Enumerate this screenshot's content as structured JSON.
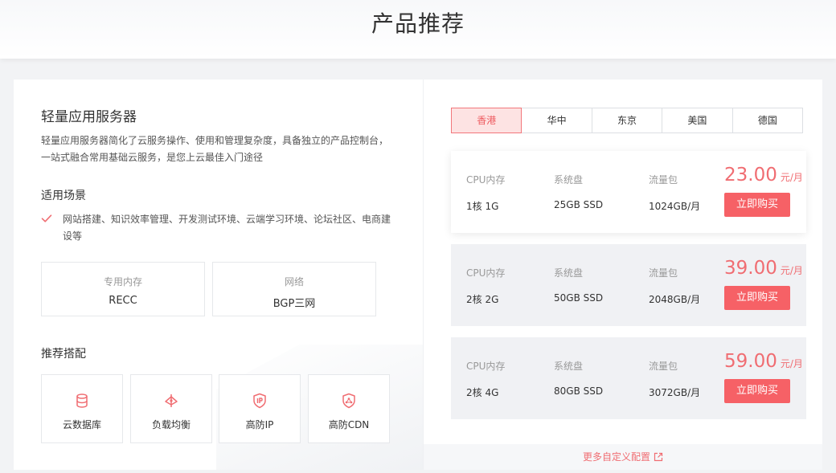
{
  "header": {
    "title": "产品推荐"
  },
  "product": {
    "title": "轻量应用服务器",
    "description_line1": "轻量应用服务器简化了云服务操作、使用和管理复杂度，具备独立的产品控制台，",
    "description_line2": "一站式融合常用基础云服务，是您上云最佳入门途径"
  },
  "scenarios": {
    "heading": "适用场景",
    "text": "网站搭建、知识效率管理、开发测试环境、云端学习环境、论坛社区、电商建设等"
  },
  "specs": [
    {
      "label": "专用内存",
      "value": "RECC"
    },
    {
      "label": "网络",
      "value": "BGP三网"
    }
  ],
  "recommend": {
    "heading": "推荐搭配",
    "items": [
      {
        "label": "云数据库",
        "icon": "database-icon"
      },
      {
        "label": "负载均衡",
        "icon": "load-balance-icon"
      },
      {
        "label": "高防IP",
        "icon": "shield-ip-icon"
      },
      {
        "label": "高防CDN",
        "icon": "shield-cdn-icon"
      }
    ]
  },
  "regions": {
    "items": [
      "香港",
      "华中",
      "东京",
      "美国",
      "德国"
    ],
    "active": "香港"
  },
  "plans": [
    {
      "cpu_label": "CPU内存",
      "cpu": "1核 1G",
      "disk_label": "系统盘",
      "disk": "25GB SSD",
      "traffic_label": "流量包",
      "traffic": "1024GB/月",
      "price": "23.00",
      "unit": "元/月",
      "buy": "立即购买"
    },
    {
      "cpu_label": "CPU内存",
      "cpu": "2核 2G",
      "disk_label": "系统盘",
      "disk": "50GB SSD",
      "traffic_label": "流量包",
      "traffic": "2048GB/月",
      "price": "39.00",
      "unit": "元/月",
      "buy": "立即购买"
    },
    {
      "cpu_label": "CPU内存",
      "cpu": "2核 4G",
      "disk_label": "系统盘",
      "disk": "80GB SSD",
      "traffic_label": "流量包",
      "traffic": "3072GB/月",
      "price": "59.00",
      "unit": "元/月",
      "buy": "立即购买"
    }
  ],
  "more_link": "更多自定义配置",
  "colors": {
    "accent": "#f66166",
    "accent_light": "#fde3e3",
    "text": "#333333",
    "muted": "#999999"
  }
}
